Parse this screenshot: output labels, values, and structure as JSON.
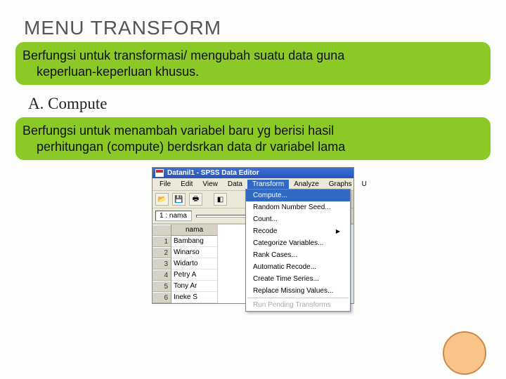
{
  "title": "MENU TRANSFORM",
  "desc1_line1": "Berfungsi untuk transformasi/ mengubah suatu data guna",
  "desc1_line2": "keperluan-keperluan khusus.",
  "subheading": "A. Compute",
  "desc2_line1": "Berfungsi untuk menambah variabel baru yg berisi hasil",
  "desc2_line2": "perhitungan (compute) berdsrkan data dr variabel lama",
  "spss": {
    "window_title": "Datanil1 - SPSS Data Editor",
    "menubar": [
      "File",
      "Edit",
      "View",
      "Data",
      "Transform",
      "Analyze",
      "Graphs",
      "U"
    ],
    "active_menu_index": 4,
    "cell_label": "1 : nama",
    "col_header": "nama",
    "rows": [
      {
        "n": "1",
        "v": "Bambang"
      },
      {
        "n": "2",
        "v": "Winarso"
      },
      {
        "n": "3",
        "v": "Widarto"
      },
      {
        "n": "4",
        "v": "Petry A"
      },
      {
        "n": "5",
        "v": "Tony Ar"
      },
      {
        "n": "6",
        "v": "Ineke S"
      }
    ],
    "dropdown": [
      {
        "label": "Compute...",
        "hover": true
      },
      {
        "label": "Random Number Seed..."
      },
      {
        "label": "Count..."
      },
      {
        "label": "Recode",
        "arrow": true
      },
      {
        "label": "Categorize Variables..."
      },
      {
        "label": "Rank Cases..."
      },
      {
        "label": "Automatic Recode..."
      },
      {
        "label": "Create Time Series..."
      },
      {
        "label": "Replace Missing Values..."
      },
      {
        "sep": true
      },
      {
        "label": "Run Pending Transforms",
        "disabled": true
      }
    ]
  }
}
